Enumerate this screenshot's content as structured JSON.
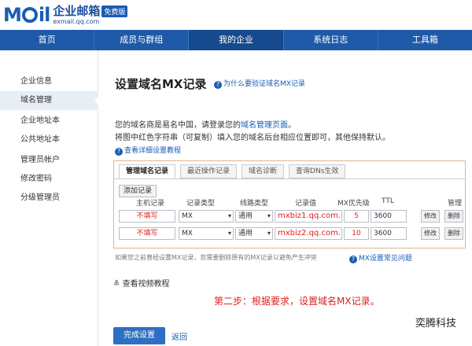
{
  "header": {
    "logo_mail": "M",
    "logo_il": "il",
    "logo_cn": "企业邮箱",
    "logo_url": "exmail.qq.com",
    "logo_badge": "免费版"
  },
  "nav": {
    "items": [
      "首页",
      "成员与群组",
      "我的企业",
      "系统日志",
      "工具箱"
    ],
    "active_index": 2
  },
  "sidebar": {
    "items": [
      "企业信息",
      "域名管理",
      "企业地址本",
      "公共地址本",
      "管理员帐户",
      "修改密码",
      "分级管理员"
    ],
    "active_index": 1
  },
  "main": {
    "title": "设置域名MX记录",
    "why_link": "为什么要验证域名MX记录",
    "desc1_prefix": "您的域名商是易名中国，请登录您的",
    "desc1_link": "域名管理页面",
    "desc1_suffix": "。",
    "desc2": "将图中红色字符串（可复制）填入您的域名后台相应位置即可，其他保持默认。",
    "detail_link": "查看详细设置教程",
    "tabs": [
      "管理域名记录",
      "最近操作记录",
      "域名诊断",
      "查询DNs生效"
    ],
    "add_button": "添加记录",
    "columns": [
      "主机记录",
      "记录类型",
      "线路类型",
      "记录值",
      "MX优先级",
      "TTL",
      "管理"
    ],
    "rows": [
      {
        "host": "不填写",
        "type": "MX",
        "line": "通用",
        "value": "mxbiz1.qq.com.",
        "priority": "5",
        "ttl": "3600",
        "edit": "修改",
        "delete": "删除"
      },
      {
        "host": "不填写",
        "type": "MX",
        "line": "通用",
        "value": "mxbiz2.qq.com.",
        "priority": "10",
        "ttl": "3600",
        "edit": "修改",
        "delete": "删除"
      }
    ],
    "note": "如果您之前曾经设置MX记录，您需要删除原有的MX记录以避免产生冲突",
    "note_link": "MX设置常见问题",
    "video_link": "查看视频教程",
    "step_text": "第二步：根据要求，设置域名MX记录。",
    "finish_button": "完成设置",
    "back_link": "返回"
  },
  "watermark": "奕腾科技"
}
